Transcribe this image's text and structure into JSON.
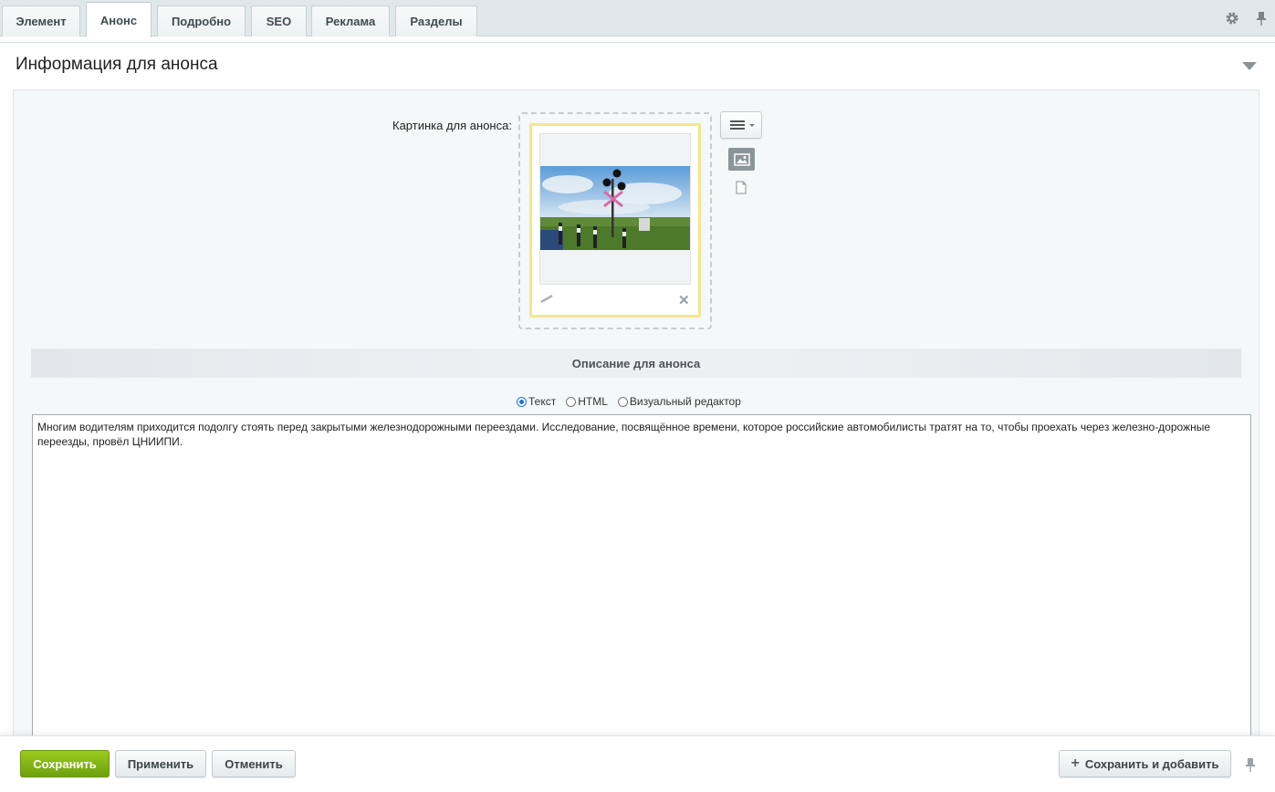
{
  "tabs": [
    {
      "label": "Элемент"
    },
    {
      "label": "Анонс"
    },
    {
      "label": "Подробно"
    },
    {
      "label": "SEO"
    },
    {
      "label": "Реклама"
    },
    {
      "label": "Разделы"
    }
  ],
  "active_tab": "Анонс",
  "toolbar_icons": [
    "gear-icon",
    "pin-icon"
  ],
  "section": {
    "title": "Информация для анонса"
  },
  "preview_picture": {
    "label": "Картинка для анонса:",
    "icons": [
      "menu-icon",
      "image-mode-icon",
      "file-mode-icon",
      "edit-icon",
      "delete-icon"
    ]
  },
  "description": {
    "header": "Описание для анонса",
    "modes": [
      {
        "label": "Текст",
        "selected": true
      },
      {
        "label": "HTML",
        "selected": false
      },
      {
        "label": "Визуальный редактор",
        "selected": false
      }
    ],
    "text": "Многим водителям приходится подолгу стоять перед закрытыми железнодорожными переездами. Исследование, посвящённое времени, которое российские автомобилисты тратят на то, чтобы проехать через железно-дорожные переезды, провёл ЦНИИПИ."
  },
  "footer": {
    "save": "Сохранить",
    "apply": "Применить",
    "cancel": "Отменить",
    "save_and_add": "Сохранить и добавить"
  },
  "colors": {
    "primary_button": "#7db015",
    "tab_bar": "#e0e8ea",
    "image_card_border": "#f5e68c"
  }
}
